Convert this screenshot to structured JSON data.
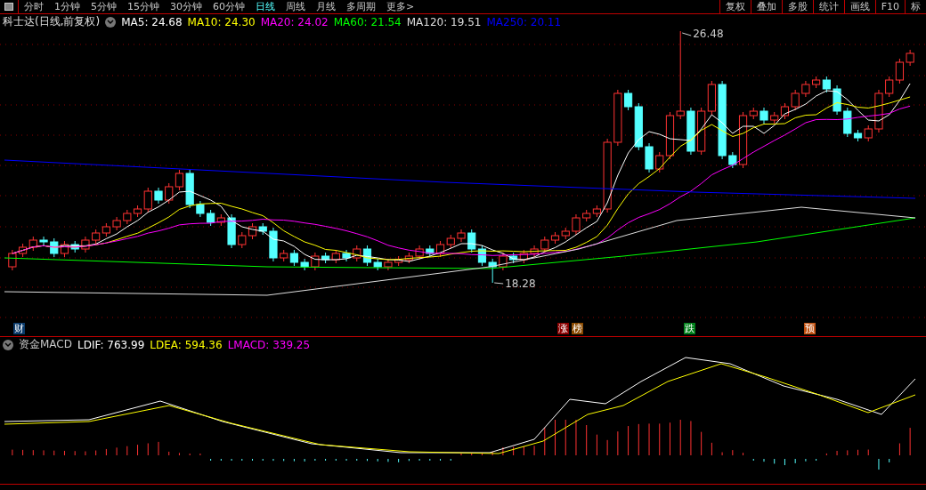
{
  "toolbar": {
    "periods": [
      {
        "label": "分时",
        "selected": false
      },
      {
        "label": "1分钟",
        "selected": false
      },
      {
        "label": "5分钟",
        "selected": false
      },
      {
        "label": "15分钟",
        "selected": false
      },
      {
        "label": "30分钟",
        "selected": false
      },
      {
        "label": "60分钟",
        "selected": false
      },
      {
        "label": "日线",
        "selected": true
      },
      {
        "label": "周线",
        "selected": false
      },
      {
        "label": "月线",
        "selected": false
      },
      {
        "label": "多周期",
        "selected": false
      },
      {
        "label": "更多>",
        "selected": false
      }
    ],
    "buttons": [
      "复权",
      "叠加",
      "多股",
      "统计",
      "画线",
      "F10",
      "标"
    ]
  },
  "main_chart": {
    "title": "科士达(日线,前复权)",
    "ma_legend": [
      {
        "label": "MA5: 24.68",
        "color": "#ffffff"
      },
      {
        "label": "MA10: 24.30",
        "color": "#ffff00"
      },
      {
        "label": "MA20: 24.02",
        "color": "#ff00ff"
      },
      {
        "label": "MA60: 21.54",
        "color": "#00ff00"
      },
      {
        "label": "MA120: 19.51",
        "color": "#dddddd"
      },
      {
        "label": "MA250: 20.11",
        "color": "#0000ff"
      }
    ],
    "high_label": "26.48",
    "low_label": "18.28",
    "markers": [
      {
        "label": "财",
        "color": "#0a3a6a"
      },
      {
        "label": "涨",
        "color": "#8a0000"
      },
      {
        "label": "榜",
        "color": "#8a4a00"
      },
      {
        "label": "跌",
        "color": "#00801a"
      },
      {
        "label": "预",
        "color": "#c05010"
      }
    ]
  },
  "indicator": {
    "title": "资金MACD",
    "values": [
      {
        "label": "LDIF: 763.99",
        "color": "#ffffff"
      },
      {
        "label": "LDEA: 594.36",
        "color": "#ffff00"
      },
      {
        "label": "LMACD: 339.25",
        "color": "#ff00ff"
      }
    ]
  }
}
